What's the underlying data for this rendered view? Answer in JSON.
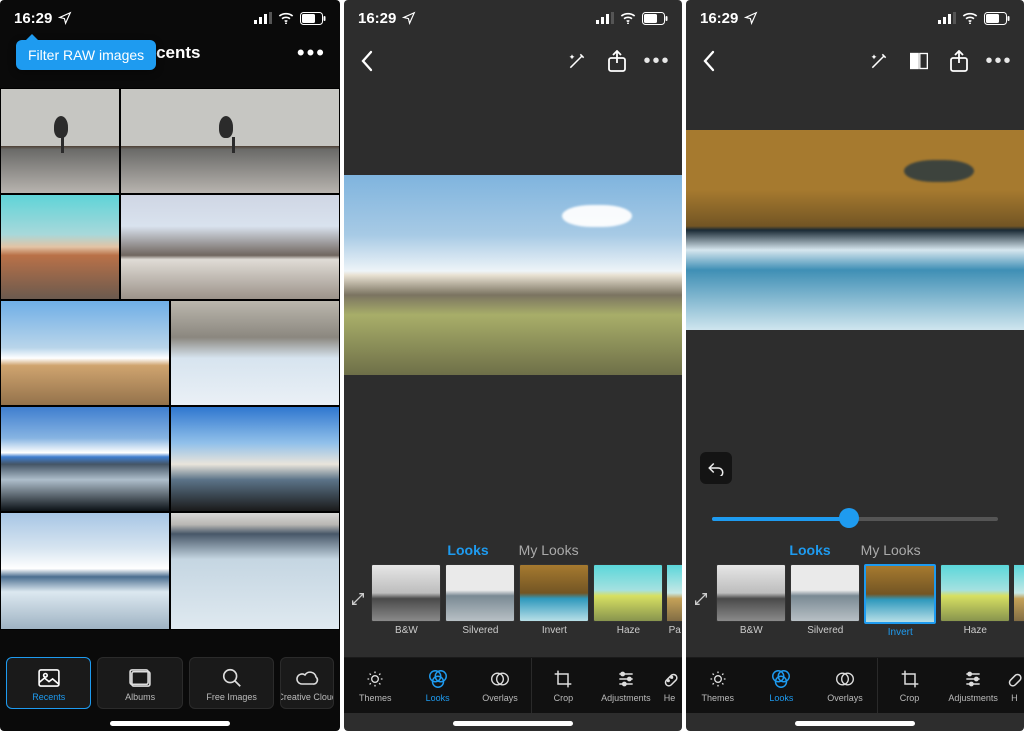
{
  "status": {
    "time": "16:29"
  },
  "screen1": {
    "tooltip": "Filter RAW images",
    "title": "Recents",
    "tabs": [
      {
        "label": "Recents"
      },
      {
        "label": "Albums"
      },
      {
        "label": "Free Images"
      },
      {
        "label": "Creative Cloud"
      }
    ]
  },
  "editor": {
    "looks_tab": "Looks",
    "mylooks_tab": "My Looks",
    "slider_value_pct": 48,
    "looks": [
      {
        "label": "B&W"
      },
      {
        "label": "Silvered"
      },
      {
        "label": "Invert"
      },
      {
        "label": "Haze"
      },
      {
        "label": "Pa"
      }
    ],
    "tools": [
      {
        "label": "Themes"
      },
      {
        "label": "Looks"
      },
      {
        "label": "Overlays"
      },
      {
        "label": "Crop"
      },
      {
        "label": "Adjustments"
      },
      {
        "label": "He"
      }
    ]
  },
  "screen3_selected_look": "Invert"
}
